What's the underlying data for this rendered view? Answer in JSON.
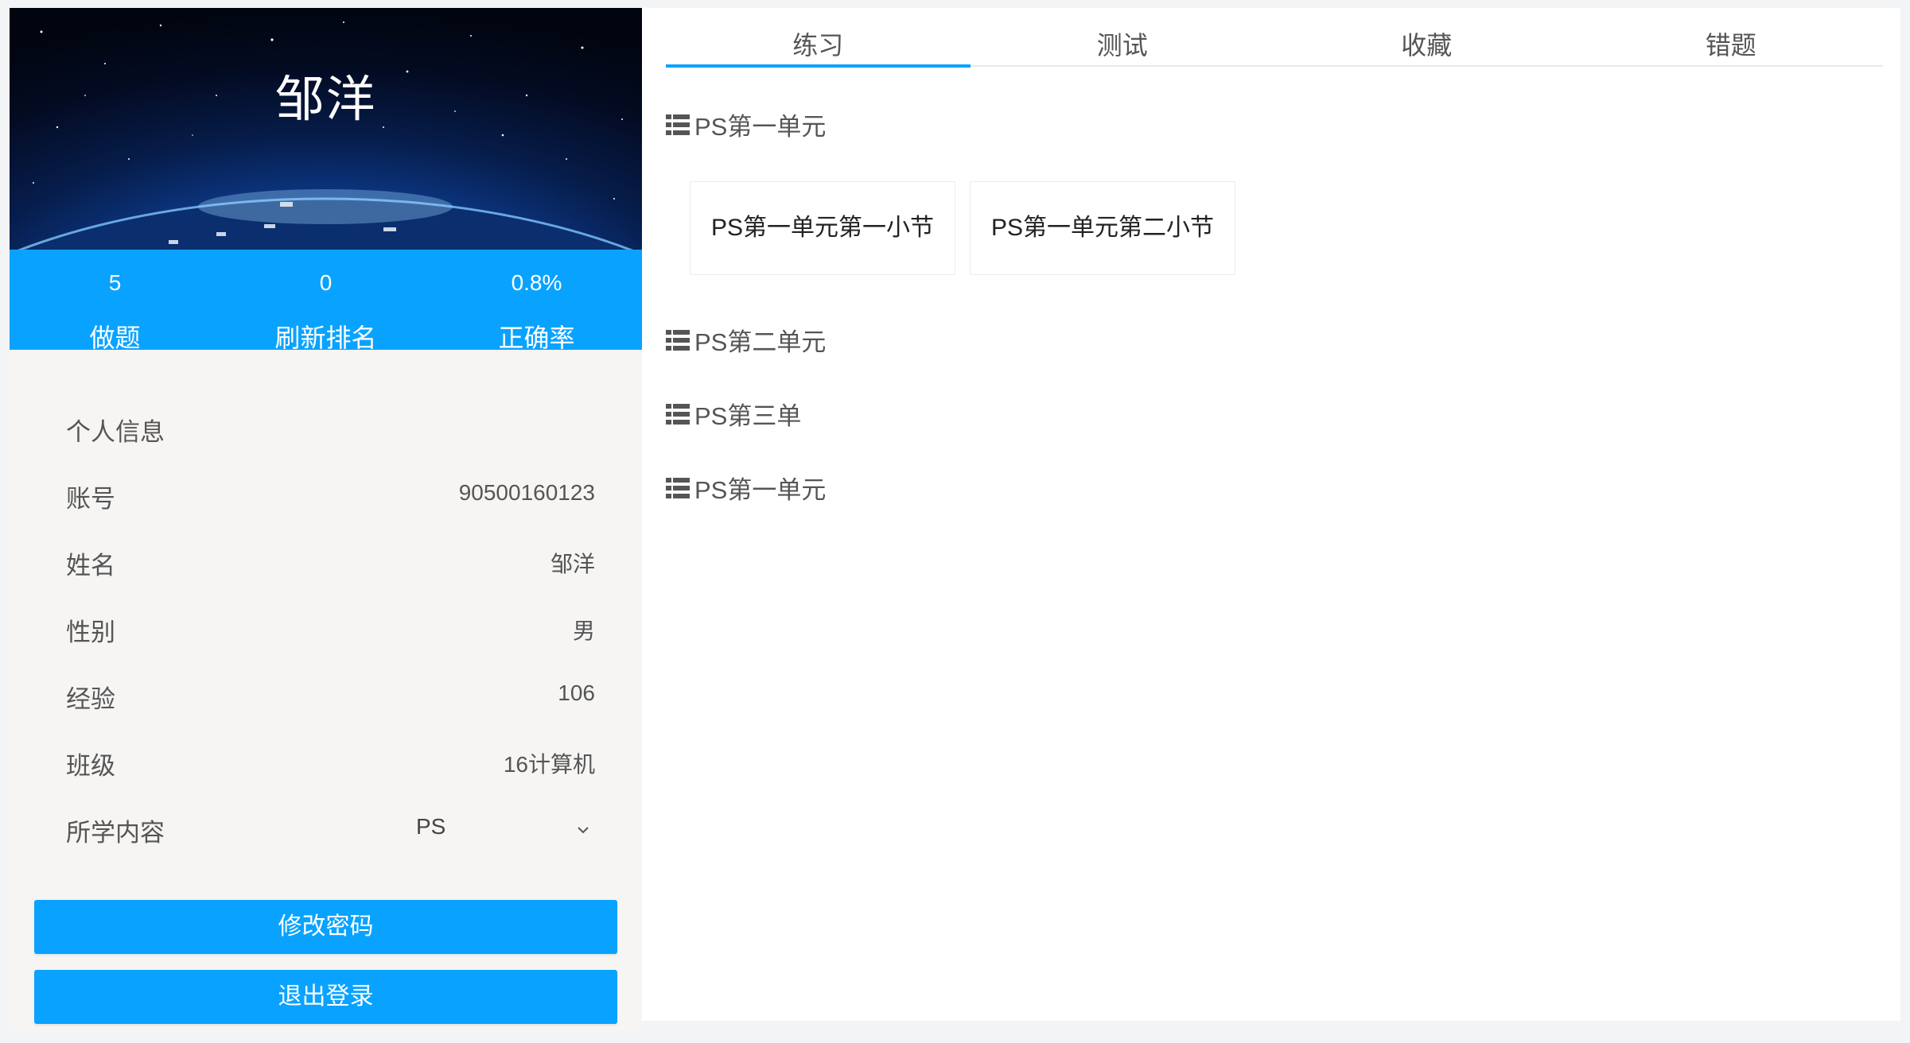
{
  "profile": {
    "name": "邹洋",
    "stats": [
      {
        "value": "5",
        "label": "做题"
      },
      {
        "value": "0",
        "label": "刷新排名"
      },
      {
        "value": "0.8%",
        "label": "正确率"
      }
    ]
  },
  "info": {
    "title": "个人信息",
    "rows": [
      {
        "label": "账号",
        "value": "90500160123"
      },
      {
        "label": "姓名",
        "value": "邹洋"
      },
      {
        "label": "性别",
        "value": "男"
      },
      {
        "label": "经验",
        "value": "106"
      },
      {
        "label": "班级",
        "value": "16计算机"
      }
    ],
    "course": {
      "label": "所学内容",
      "value": "PS"
    }
  },
  "buttons": {
    "change_password": "修改密码",
    "logout": "退出登录"
  },
  "tabs": [
    "练习",
    "测试",
    "收藏",
    "错题"
  ],
  "active_tab": 0,
  "units": [
    {
      "title": "PS第一单元",
      "sections": [
        "PS第一单元第一小节",
        "PS第一单元第二小节"
      ]
    },
    {
      "title": "PS第二单元"
    },
    {
      "title": "PS第三单"
    },
    {
      "title": "PS第一单元"
    }
  ],
  "colors": {
    "accent": "#09a3ff",
    "banner_dark": "#030b22"
  },
  "icons": {
    "unit": "list-icon",
    "dropdown": "chevron-down-icon"
  }
}
